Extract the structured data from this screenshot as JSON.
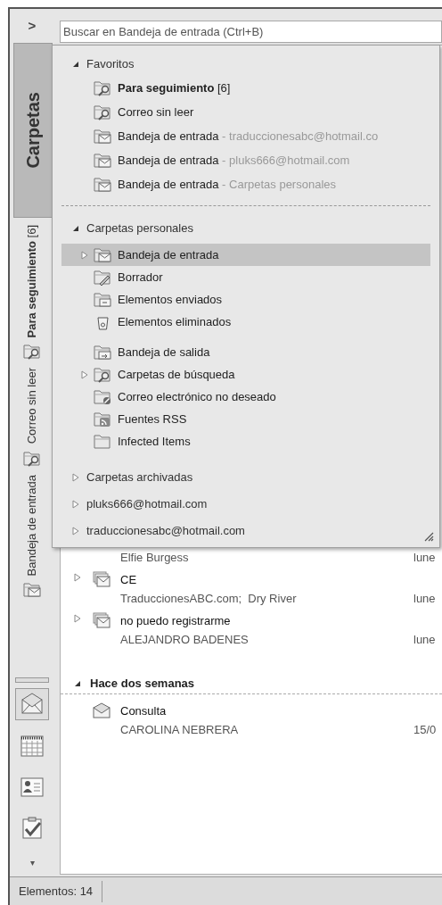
{
  "nav_pane": {
    "expand_button": ">",
    "folders_button": {
      "label": "Carpetas",
      "selected": true
    },
    "shortcuts": [
      {
        "label": "**Para seguimiento** [6]",
        "kind": "search"
      },
      {
        "label": "Correo sin leer",
        "kind": "search"
      },
      {
        "label": "Bandeja de entrada",
        "kind": "inbox"
      }
    ],
    "modules": [
      {
        "kind": "mail",
        "selected": true
      },
      {
        "kind": "calendar",
        "selected": false
      },
      {
        "kind": "contacts",
        "selected": false
      },
      {
        "kind": "tasks",
        "selected": false
      }
    ],
    "more_button": "▾"
  },
  "search": {
    "placeholder": "Buscar en Bandeja de entrada (Ctrl+B)"
  },
  "folder_popup": {
    "sections": [
      {
        "title": "Favoritos",
        "expanded": true,
        "groups": [
          [
            {
              "label": "**Para seguimiento** [6]",
              "kind": "search",
              "selected": false
            },
            {
              "label": "Correo sin leer",
              "kind": "search",
              "selected": false
            },
            {
              "label": "Bandeja de entrada",
              "detail": "- traduccionesabc@hotmail.co",
              "kind": "inbox",
              "selected": false
            },
            {
              "label": "Bandeja de entrada",
              "detail": "- pluks666@hotmail.com",
              "kind": "inbox",
              "selected": false
            },
            {
              "label": "Bandeja de entrada",
              "detail": "- Carpetas personales",
              "kind": "inbox",
              "selected": false
            }
          ]
        ]
      },
      {
        "title": "Carpetas personales",
        "expanded": true,
        "groups": [
          [
            {
              "label": "Bandeja de entrada",
              "kind": "inbox",
              "selected": true,
              "expandable": true
            },
            {
              "label": "Borrador",
              "kind": "drafts",
              "selected": false
            },
            {
              "label": "Elementos enviados",
              "kind": "sent",
              "selected": false
            },
            {
              "label": "Elementos eliminados",
              "kind": "deleted",
              "selected": false
            }
          ],
          [
            {
              "label": "Bandeja de salida",
              "kind": "outbox",
              "selected": false
            },
            {
              "label": "Carpetas de búsqueda",
              "kind": "search",
              "selected": false,
              "expandable": true
            },
            {
              "label": "Correo electrónico no deseado",
              "kind": "junk",
              "selected": false
            },
            {
              "label": "Fuentes RSS",
              "kind": "rss",
              "selected": false
            },
            {
              "label": "Infected Items",
              "kind": "folder",
              "selected": false
            }
          ]
        ]
      },
      {
        "title": "Carpetas archivadas",
        "expanded": false
      },
      {
        "title": "pluks666@hotmail.com",
        "expanded": false
      },
      {
        "title": "traduccionesabc@hotmail.com",
        "expanded": false
      }
    ]
  },
  "messages": {
    "groups": [
      {
        "items": [
          {
            "from": "Elfie Burgess",
            "date": "lune"
          },
          {
            "subject": "CE",
            "from": "TraduccionesABC.com;  Dry River",
            "date": "lune",
            "kind": "conversation"
          },
          {
            "subject": "no puedo registrarme",
            "from": "ALEJANDRO BADENES",
            "date": "lune",
            "kind": "conversation"
          }
        ]
      },
      {
        "title": "Hace dos semanas",
        "expanded": true,
        "items": [
          {
            "subject": "Consulta",
            "from": "CAROLINA NEBRERA",
            "date": "15/0",
            "kind": "single"
          }
        ]
      }
    ]
  },
  "status_bar": {
    "items_count": "Elementos: 14"
  }
}
